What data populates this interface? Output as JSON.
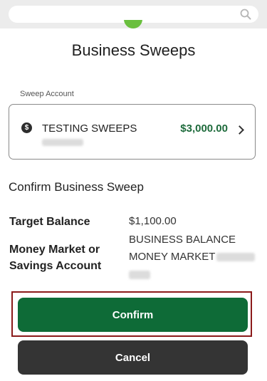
{
  "search": {
    "placeholder": "",
    "icon": "search-icon"
  },
  "header": {
    "title": "Business Sweeps"
  },
  "sweep_account": {
    "label": "Sweep Account",
    "name": "TESTING SWEEPS",
    "amount": "$3,000.00",
    "icon": "dollar-icon",
    "amount_color": "#1e6b3c"
  },
  "confirm": {
    "heading": "Confirm Business Sweep",
    "target_balance_label": "Target Balance",
    "target_balance_value": "$1,100.00",
    "destination_label_line1": "Money Market or",
    "destination_label_line2": "Savings Account",
    "destination_value_line1": "BUSINESS BALANCE",
    "destination_value_line2": "MONEY MARKET"
  },
  "buttons": {
    "confirm_label": "Confirm",
    "cancel_label": "Cancel",
    "confirm_color": "#0e6b37",
    "cancel_color": "#343434",
    "focus_outline_color": "#8b1a1a"
  }
}
